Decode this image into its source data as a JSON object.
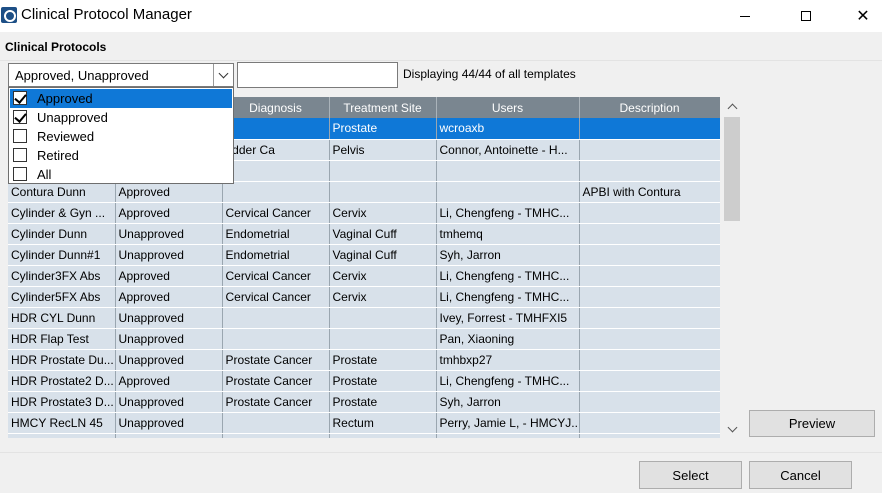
{
  "window": {
    "title": "Clinical Protocol Manager",
    "min_glyph": "",
    "close_glyph": "✕"
  },
  "section": {
    "label": "Clinical Protocols"
  },
  "filter": {
    "value": "Approved, Unapproved",
    "search_value": "",
    "display_count": "Displaying 44/44 of all templates"
  },
  "dropdown": {
    "options": [
      {
        "label": "Approved",
        "checked": true,
        "highlighted": true
      },
      {
        "label": "Unapproved",
        "checked": true,
        "highlighted": false
      },
      {
        "label": "Reviewed",
        "checked": false,
        "highlighted": false
      },
      {
        "label": "Retired",
        "checked": false,
        "highlighted": false
      },
      {
        "label": "All",
        "checked": false,
        "highlighted": false
      }
    ]
  },
  "grid": {
    "columns": [
      "",
      "",
      "Diagnosis",
      "Treatment Site",
      "Users",
      "Description"
    ],
    "rows": [
      {
        "cells": [
          "",
          "",
          "",
          "Prostate",
          "wcroaxb",
          ""
        ],
        "selected": true
      },
      {
        "cells": [
          "",
          "",
          "adder Ca",
          "Pelvis",
          "Connor, Antoinette - H...",
          ""
        ],
        "selected": false
      },
      {
        "cells": [
          "",
          "",
          "",
          "",
          "",
          ""
        ],
        "selected": false
      },
      {
        "cells": [
          "Contura Dunn",
          "Approved",
          "",
          "",
          "",
          "APBI with Contura"
        ],
        "selected": false
      },
      {
        "cells": [
          "Cylinder & Gyn ...",
          "Approved",
          "Cervical Cancer",
          "Cervix",
          "Li, Chengfeng - TMHC...",
          ""
        ],
        "selected": false
      },
      {
        "cells": [
          "Cylinder Dunn",
          "Unapproved",
          "Endometrial",
          "Vaginal Cuff",
          "tmhemq",
          ""
        ],
        "selected": false
      },
      {
        "cells": [
          "Cylinder Dunn#1",
          "Unapproved",
          "Endometrial",
          "Vaginal Cuff",
          "Syh, Jarron",
          ""
        ],
        "selected": false
      },
      {
        "cells": [
          "Cylinder3FX Abs",
          "Approved",
          "Cervical Cancer",
          "Cervix",
          "Li, Chengfeng - TMHC...",
          ""
        ],
        "selected": false
      },
      {
        "cells": [
          "Cylinder5FX Abs",
          "Approved",
          "Cervical Cancer",
          "Cervix",
          "Li, Chengfeng - TMHC...",
          ""
        ],
        "selected": false
      },
      {
        "cells": [
          "HDR CYL Dunn",
          "Unapproved",
          "",
          "",
          "Ivey, Forrest - TMHFXI5",
          ""
        ],
        "selected": false
      },
      {
        "cells": [
          "HDR Flap Test",
          "Unapproved",
          "",
          "",
          "Pan, Xiaoning",
          ""
        ],
        "selected": false
      },
      {
        "cells": [
          "HDR Prostate Du...",
          "Unapproved",
          "Prostate Cancer",
          "Prostate",
          "tmhbxp27",
          ""
        ],
        "selected": false
      },
      {
        "cells": [
          "HDR Prostate2 D...",
          "Approved",
          "Prostate Cancer",
          "Prostate",
          "Li, Chengfeng - TMHC...",
          ""
        ],
        "selected": false
      },
      {
        "cells": [
          "HDR Prostate3 D...",
          "Unapproved",
          "Prostate Cancer",
          "Prostate",
          "Syh, Jarron",
          ""
        ],
        "selected": false
      },
      {
        "cells": [
          "HMCY RecLN 45",
          "Unapproved",
          "",
          "Rectum",
          "Perry, Jamie L, - HMCYJ...",
          ""
        ],
        "selected": false
      },
      {
        "cells": [
          "",
          "",
          "",
          "",
          "",
          ""
        ],
        "selected": false
      }
    ]
  },
  "buttons": {
    "preview": "Preview",
    "select": "Select",
    "cancel": "Cancel"
  },
  "colors": {
    "header_bg": "#7a8690",
    "row_bg": "#d8e1ea",
    "selection": "#0f78d7"
  }
}
